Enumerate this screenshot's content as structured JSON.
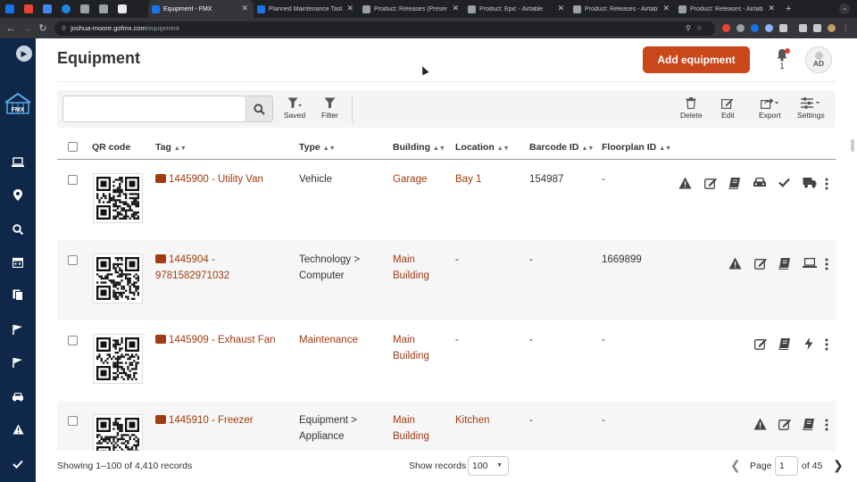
{
  "browser": {
    "pinned_favicons": [
      "s-icon",
      "gmail-icon",
      "docs-icon",
      "sync-icon",
      "reader-icon",
      "p-icon",
      "calendar-icon"
    ],
    "tabs": [
      {
        "label": "Equipment - FMX",
        "active": true
      },
      {
        "label": "Planned Maintenance Tasks -",
        "active": false
      },
      {
        "label": "Product: Releases (Presentat",
        "active": false
      },
      {
        "label": "Product: Epic - Airtable",
        "active": false
      },
      {
        "label": "Product: Releases - Airtable",
        "active": false
      },
      {
        "label": "Product: Releases - Airtable",
        "active": false
      }
    ],
    "url_host": "joshua-moore.gofmx.com",
    "url_path": "/equipment"
  },
  "sidebar": {
    "items": [
      "laptop-icon",
      "location-icon",
      "search-icon",
      "calendar-icon",
      "documents-icon",
      "flag-icon",
      "flag-icon",
      "car-icon",
      "warning-icon",
      "check-icon"
    ]
  },
  "header": {
    "title": "Equipment",
    "add_button": "Add equipment",
    "notification_count": "1",
    "avatar_initials": "AD"
  },
  "toolbar": {
    "search_placeholder": "",
    "saved_label": "Saved",
    "filter_label": "Filter",
    "delete_label": "Delete",
    "edit_label": "Edit",
    "export_label": "Export",
    "settings_label": "Settings"
  },
  "table": {
    "columns": [
      "QR code",
      "Tag",
      "Type",
      "Building",
      "Location",
      "Barcode ID",
      "Floorplan ID"
    ],
    "rows": [
      {
        "tag": "1445900 - Utility Van",
        "type": "Vehicle",
        "building": "Garage",
        "location": "Bay 1",
        "barcode": "154987",
        "floorplan": "-",
        "actions": [
          "warning-icon",
          "edit-icon",
          "book-icon",
          "car-icon",
          "check-icon",
          "truck-icon"
        ]
      },
      {
        "tag": "1445904 - 9781582971032",
        "type": "Technology > Computer",
        "building": "Main Building",
        "location": "-",
        "barcode": "-",
        "floorplan": "1669899",
        "actions": [
          "warning-icon",
          "edit-icon",
          "book-icon",
          "laptop-icon"
        ]
      },
      {
        "tag": "1445909 - Exhaust Fan",
        "type": "Maintenance",
        "building": "Main Building",
        "location": "-",
        "barcode": "-",
        "floorplan": "-",
        "actions": [
          "edit-icon",
          "book-icon",
          "bolt-icon"
        ]
      },
      {
        "tag": "1445910 - Freezer",
        "type": "Equipment > Appliance",
        "building": "Main Building",
        "location": "Kitchen",
        "barcode": "-",
        "floorplan": "-",
        "actions": [
          "warning-icon",
          "edit-icon",
          "book-icon"
        ]
      }
    ]
  },
  "footer": {
    "records_text": "Showing 1–100 of 4,410 records",
    "show_records_label": "Show records",
    "show_records_value": "100",
    "page_label": "Page",
    "page_value": "1",
    "page_of": "of 45"
  },
  "colors": {
    "accent": "#c9471b",
    "link": "#a13c12",
    "sidebar": "#0f2749"
  }
}
